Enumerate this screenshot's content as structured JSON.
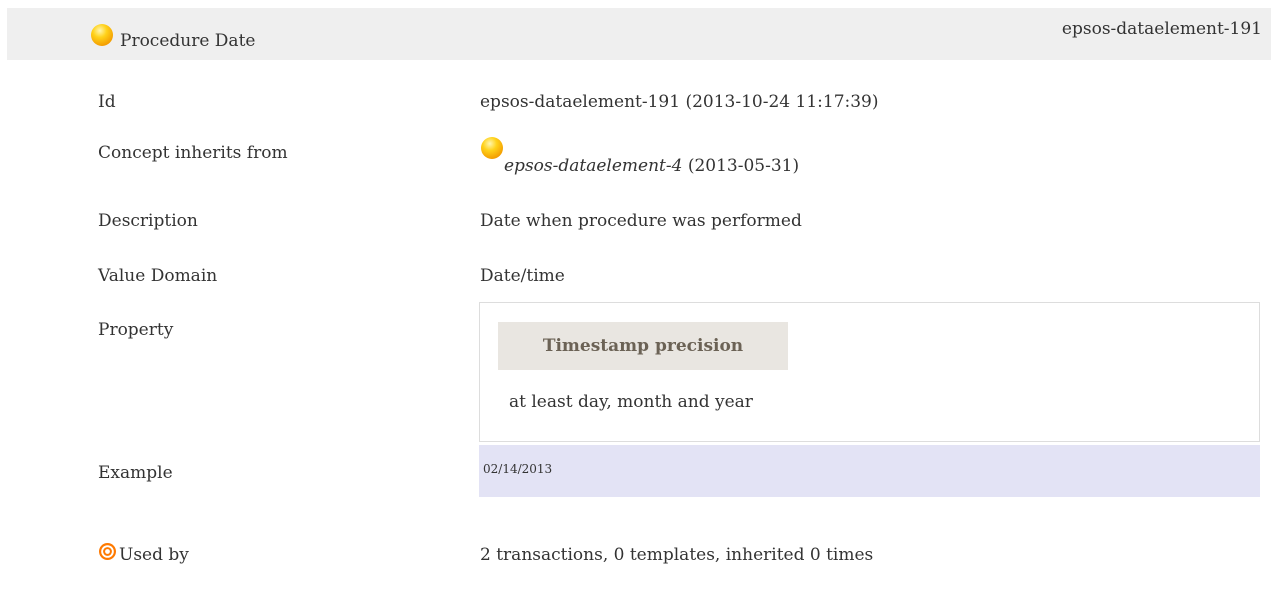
{
  "header": {
    "title": "Procedure Date",
    "element_id": "epsos-dataelement-191",
    "status_icon": "yellow-ball-icon"
  },
  "rows": {
    "id": {
      "label": "Id",
      "value": "epsos-dataelement-191 (2013-10-24 11:17:39)"
    },
    "inherits": {
      "label": "Concept inherits from",
      "link": "epsos-dataelement-4",
      "date": " (2013-05-31)",
      "icon": "yellow-ball-icon"
    },
    "description": {
      "label": "Description",
      "value": "Date when procedure was performed"
    },
    "value_domain": {
      "label": "Value Domain",
      "value": "Date/time"
    },
    "property": {
      "label": "Property",
      "heading": "Timestamp precision",
      "value": "at least day, month and year"
    },
    "example": {
      "label": "Example",
      "value": "02/14/2013"
    },
    "used_by": {
      "label": "Used by",
      "value": "2 transactions, 0 templates, inherited 0 times",
      "icon": "target-icon"
    }
  },
  "colors": {
    "header_bg": "#efefef",
    "property_heading_bg": "#e9e6e1",
    "example_bg": "#e3e3f5",
    "ball": "#ffc300",
    "target": "#ff6a00"
  }
}
